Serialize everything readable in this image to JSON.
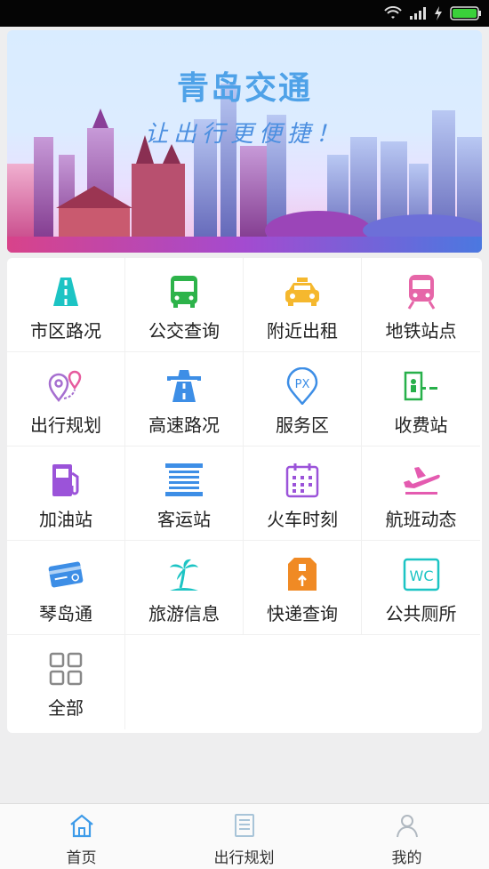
{
  "banner": {
    "title": "青岛交通",
    "slogan": "让出行更便捷！"
  },
  "grid": [
    {
      "label": "市区路况",
      "icon": "road-icon",
      "color": "#1cc4c4"
    },
    {
      "label": "公交查询",
      "icon": "bus-icon",
      "color": "#2db34a"
    },
    {
      "label": "附近出租",
      "icon": "taxi-icon",
      "color": "#f5b82e"
    },
    {
      "label": "地铁站点",
      "icon": "subway-icon",
      "color": "#e666a8"
    },
    {
      "label": "出行规划",
      "icon": "route-pins-icon",
      "color": "#a66fd0"
    },
    {
      "label": "高速路况",
      "icon": "highway-icon",
      "color": "#3d8ee6"
    },
    {
      "label": "服务区",
      "icon": "service-area-pin-icon",
      "color": "#3d8ee6"
    },
    {
      "label": "收费站",
      "icon": "toll-booth-icon",
      "color": "#27b04a"
    },
    {
      "label": "加油站",
      "icon": "fuel-pump-icon",
      "color": "#9b53d9"
    },
    {
      "label": "客运站",
      "icon": "coach-station-icon",
      "color": "#3d8ee6"
    },
    {
      "label": "火车时刻",
      "icon": "calendar-icon",
      "color": "#9b53d9"
    },
    {
      "label": "航班动态",
      "icon": "plane-icon",
      "color": "#e45bb0"
    },
    {
      "label": "琴岛通",
      "icon": "card-icon",
      "color": "#3d8ee6"
    },
    {
      "label": "旅游信息",
      "icon": "palm-tree-icon",
      "color": "#1cc4c4"
    },
    {
      "label": "快递查询",
      "icon": "package-icon",
      "color": "#f08a24"
    },
    {
      "label": "公共厕所",
      "icon": "wc-icon",
      "color": "#1cc4c4"
    },
    {
      "label": "全部",
      "icon": "grid-all-icon",
      "color": "#888888"
    }
  ],
  "tabs": [
    {
      "label": "首页",
      "icon": "home-icon",
      "active_color": "#3d9be9"
    },
    {
      "label": "出行规划",
      "icon": "document-icon"
    },
    {
      "label": "我的",
      "icon": "user-icon"
    }
  ]
}
